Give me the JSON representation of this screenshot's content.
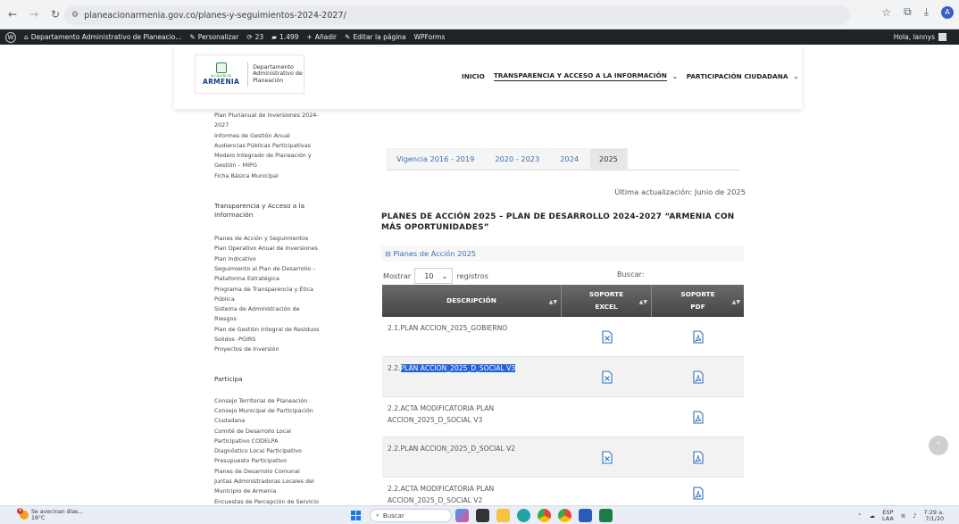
{
  "browser": {
    "url": "planeacionarmenia.gov.co/planes-y-seguimientos-2024-2027/"
  },
  "adminbar": {
    "site": "Departamento Administrativo de Planeacio...",
    "customize": "Personalizar",
    "updates": "23",
    "comments": "1.499",
    "add_new": "Añadir",
    "edit_page": "Editar la página",
    "wpforms": "WPForms",
    "greeting": "Hola, lannys"
  },
  "logo": {
    "small_text": "ALCALDÍA DE",
    "city": "ARMENIA",
    "dept": "Departamento Administrativo de Planeación"
  },
  "nav": {
    "items": [
      "INICIO",
      "TRANSPARENCIA Y ACCESO A LA INFORMACIÓN",
      "PARTICIPACIÓN CIUDADANA"
    ]
  },
  "sidebar": {
    "top_links": [
      "Plan Plurianual de Inversiones 2024-2027",
      "Informes de Gestión Anual",
      "Audiencias Públicas Participativas",
      "Modelo Integrado de Planeación y Gestión – MIPG",
      "Ficha Básica Municipal"
    ],
    "section1_title": "Transparencia y Acceso a la Información",
    "section1_links": [
      "Planes de Acción y Seguimientos",
      "Plan Operativo Anual de Inversiones",
      "Plan Indicativo",
      "Seguimiento al Plan de Desarrollo – Plataforma Estratégica",
      "Programa de Transparencia y Ética Pública",
      "Sistema de Administración de Riesgos",
      "Plan de Gestión Integral de Residuos Solidos -PGIRS",
      "Proyectos de Inversión"
    ],
    "section2_title": "Participa",
    "section2_links": [
      "Consejo Territorial de Planeación",
      "Consejo Municipal de Participación Ciudadana",
      "Comité de Desarrollo Local Participativo CODELPA",
      "Diagnóstico Local Participativo",
      "Presupuesto Participativo",
      "Planes de Desarrollo Comunal",
      "Juntas Administradoras Locales del Municipio de Armenia",
      "Encuestas de Percepción de Servicio"
    ]
  },
  "tabs": [
    "Vigencia 2016 - 2019",
    "2020 - 2023",
    "2024",
    "2025"
  ],
  "updated": "Última actualización:  Junio de 2025",
  "heading": "PLANES DE ACCIÓN 2025 – PLAN DE DESARROLLO 2024-2027 “ARMENIA CON MÁS OPORTUNIDADES”",
  "accordion": "⊟ Planes de Acción 2025",
  "table_controls": {
    "show_label": "Mostrar",
    "length": "10",
    "records_label": "registros",
    "search_label": "Buscar:"
  },
  "table": {
    "headers": [
      "DESCRIPCIÓN",
      "SOPORTE EXCEL",
      "SOPORTE PDF"
    ],
    "rows": [
      {
        "desc": "2.1.PLAN ACCION_2025_GOBIERNO"
      },
      {
        "desc_prefix": "2.2.",
        "desc_highlight": "PLAN ACCION_2025_D_SOCIAL V3"
      },
      {
        "desc": "2.2.ACTA MODIFICATORIA PLAN ACCION_2025_D_SOCIAL V3"
      },
      {
        "desc": "2.2.PLAN ACCION_2025_D_SOCIAL V2"
      },
      {
        "desc": "2.2.ACTA MODIFICATORIA PLAN ACCION_2025_D_SOCIAL V2"
      }
    ]
  },
  "taskbar": {
    "weather_text": "Se avecinan días...",
    "temp": "19°C",
    "notif": "4",
    "search": "Buscar",
    "lang1": "ESP",
    "lang2": "LAA",
    "time": "7:29 a.",
    "date": "7/1/20"
  }
}
